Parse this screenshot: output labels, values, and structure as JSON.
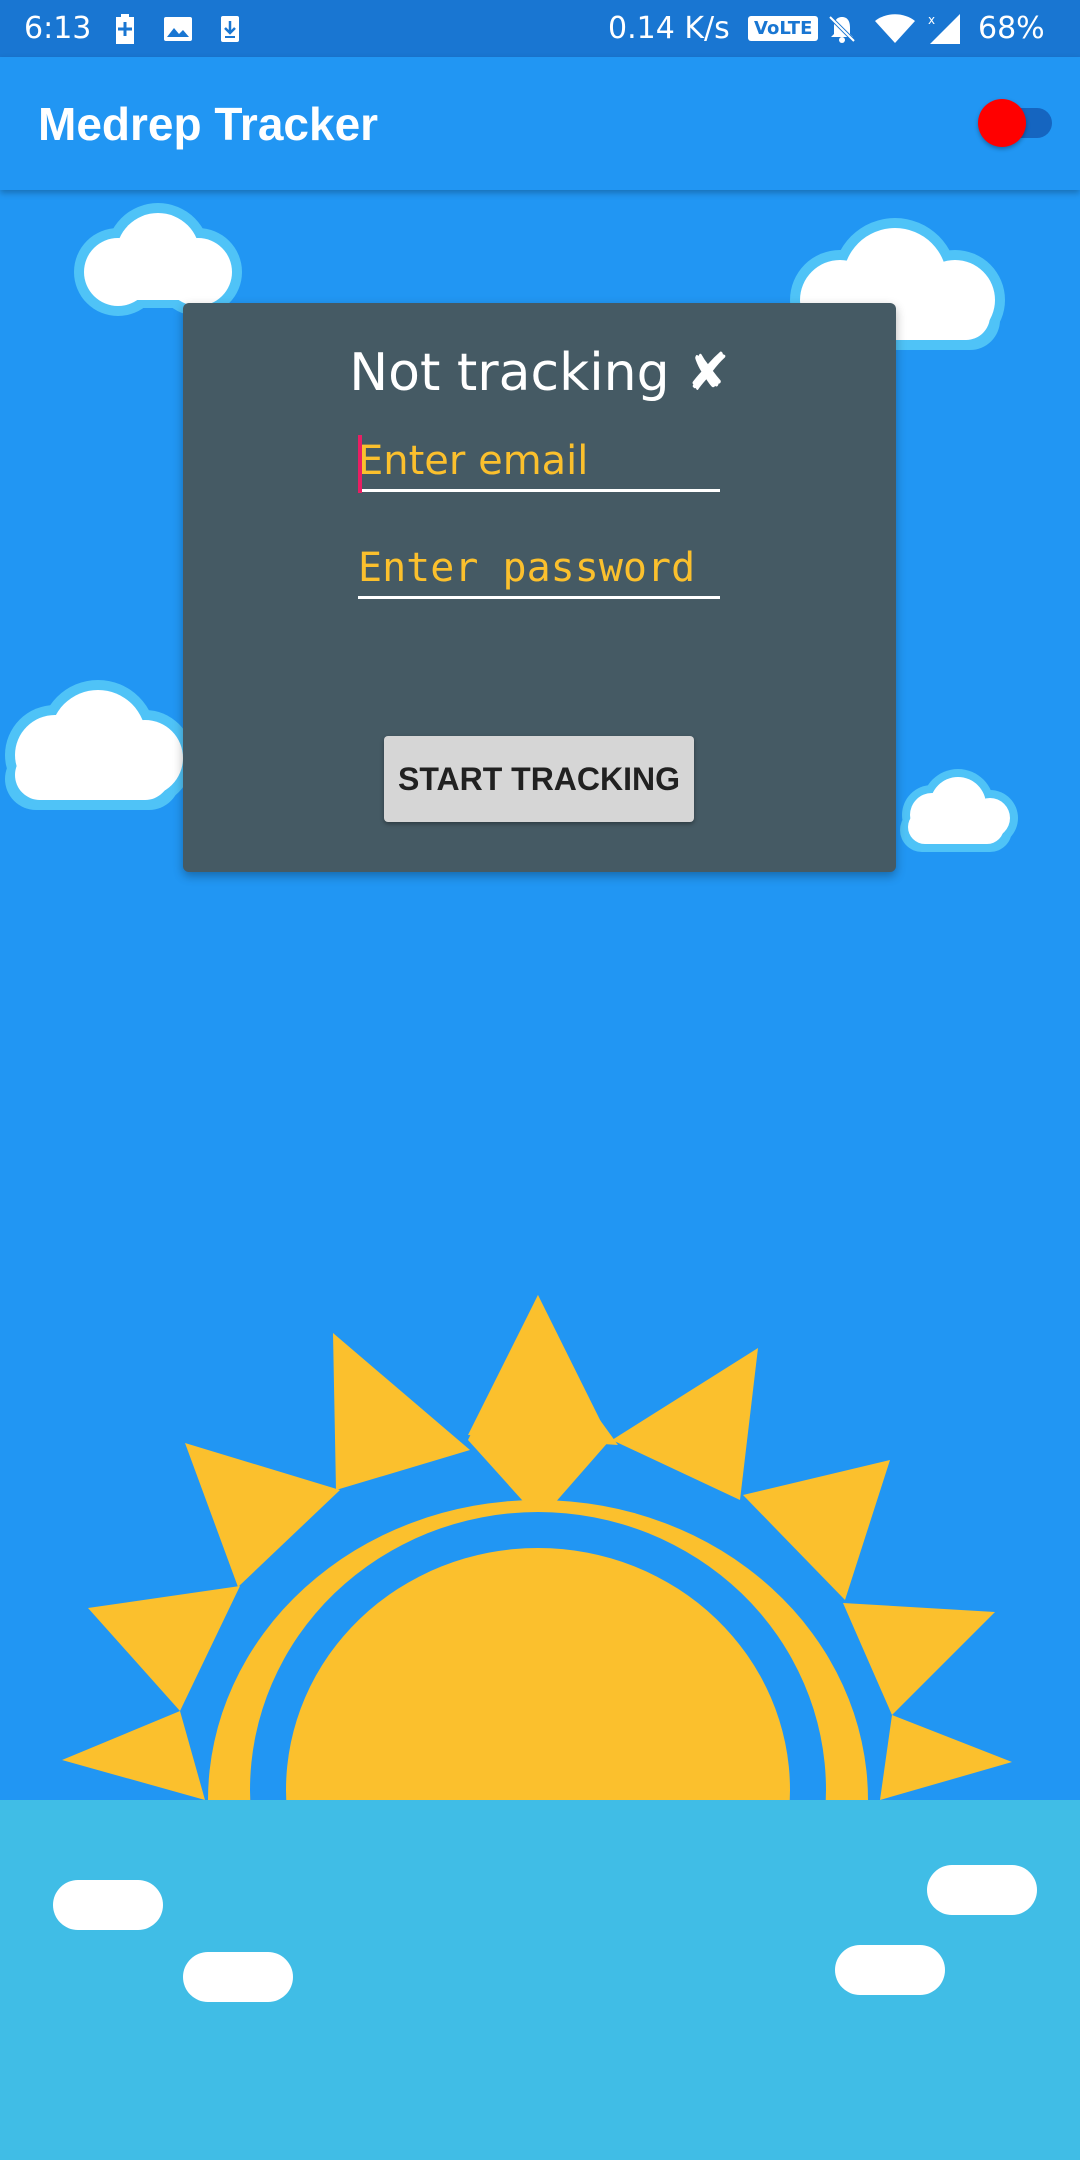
{
  "status_bar": {
    "time": "6:13",
    "network_speed": "0.14 K/s",
    "volte": "VoLTE",
    "battery_percent": "68%",
    "icons": [
      "battery-charging-icon",
      "image-icon",
      "download-icon",
      "volte-icon",
      "bell-muted-icon",
      "wifi-icon",
      "signal-icon"
    ]
  },
  "app_bar": {
    "title": "Medrep Tracker",
    "toggle": {
      "state": "off",
      "thumb_color": "#FF0000"
    }
  },
  "login_card": {
    "status_text": "Not tracking ✘",
    "email": {
      "value": "",
      "placeholder": "Enter email"
    },
    "password": {
      "value": "",
      "placeholder": "Enter password"
    },
    "start_button_label": "START TRACKING"
  },
  "colors": {
    "sky": "#2196F3",
    "card": "#455A64",
    "accent_text": "#FBC02D",
    "sun": "#FBC02D",
    "water": "#40BDE6"
  }
}
